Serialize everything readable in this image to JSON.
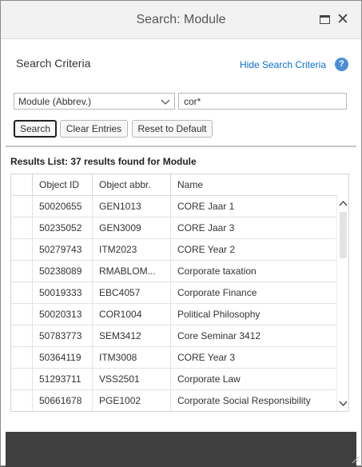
{
  "window": {
    "title": "Search: Module"
  },
  "criteria": {
    "title": "Search Criteria",
    "hide_link": "Hide Search Criteria",
    "help_glyph": "?",
    "field_select": "Module (Abbrev.)",
    "search_value": "cor*"
  },
  "buttons": {
    "search": "Search",
    "clear": "Clear Entries",
    "reset": "Reset to Default"
  },
  "results": {
    "title": "Results List: 37 results found for Module",
    "columns": [
      "",
      "Object ID",
      "Object abbr.",
      "Name"
    ],
    "rows": [
      {
        "id": "50020655",
        "abbr": "GEN1013",
        "name": "CORE Jaar 1"
      },
      {
        "id": "50235052",
        "abbr": "GEN3009",
        "name": "CORE Jaar 3"
      },
      {
        "id": "50279743",
        "abbr": "ITM2023",
        "name": "CORE Year 2"
      },
      {
        "id": "50238089",
        "abbr": "RMABLOM...",
        "name": "Corporate taxation"
      },
      {
        "id": "50019333",
        "abbr": "EBC4057",
        "name": "Corporate Finance"
      },
      {
        "id": "50020313",
        "abbr": "COR1004",
        "name": "Political Philosophy"
      },
      {
        "id": "50783773",
        "abbr": "SEM3412",
        "name": "Core Seminar 3412"
      },
      {
        "id": "50364119",
        "abbr": "ITM3008",
        "name": "CORE Year 3"
      },
      {
        "id": "51293711",
        "abbr": "VSS2501",
        "name": "Corporate Law"
      },
      {
        "id": "50661678",
        "abbr": "PGE1002",
        "name": "Corporate Social Responsibility"
      }
    ]
  },
  "colors": {
    "link": "#0a6ed1",
    "help": "#4d8fd6",
    "footer": "#3f3f3f"
  },
  "icons": {
    "maximize": "maximize-icon",
    "close": "close-icon",
    "help": "help-icon",
    "dropdown": "chevron-down-icon",
    "scroll_up": "chevron-up-icon",
    "scroll_down": "chevron-down-icon",
    "resize": "resize-grip-icon"
  }
}
